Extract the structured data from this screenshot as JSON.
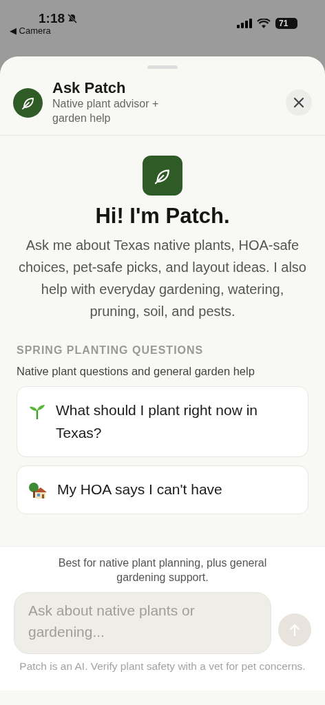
{
  "status_bar": {
    "time": "1:18",
    "back_label": "◀ Camera",
    "battery": "71"
  },
  "header": {
    "title": "Ask Patch",
    "subtitle": "Native plant advisor + garden help"
  },
  "intro": {
    "title": "Hi! I'm Patch.",
    "body": "Ask me about Texas native plants, HOA-safe choices, pet-safe picks, and layout ideas. I also help with everyday gardening, watering, pruning, soil, and pests."
  },
  "section": {
    "title": "SPRING PLANTING QUESTIONS",
    "subtitle": "Native plant questions and general garden help"
  },
  "suggestions": [
    {
      "kind": "sprout",
      "text": "What should I plant right now in Texas?"
    },
    {
      "kind": "house",
      "text": "My HOA says I can't have"
    }
  ],
  "footer": {
    "note": "Best for native plant planning, plus general gardening support.",
    "placeholder": "Ask about native plants or gardening...",
    "disclaimer": "Patch is an AI. Verify plant safety with a vet for pet concerns."
  }
}
